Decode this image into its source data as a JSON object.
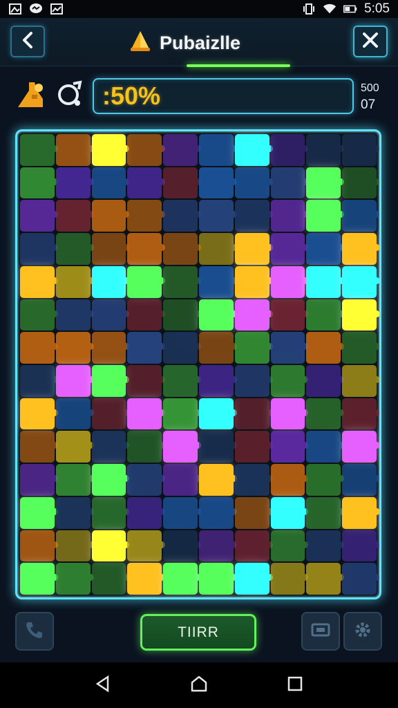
{
  "status_bar": {
    "time": "5:05",
    "left_icons": [
      "gallery-icon",
      "messenger-icon",
      "image-icon"
    ],
    "right_icons": [
      "vibrate-icon",
      "wifi-icon",
      "battery-icon"
    ]
  },
  "header": {
    "title": "Pubaizlle",
    "back_icon": "chevron-left-icon",
    "close_icon": "close-icon"
  },
  "progress": {
    "text": ":50%",
    "counter_top": "500",
    "counter_bottom": "07"
  },
  "tools": [
    "hint-icon",
    "shuffle-icon"
  ],
  "board": {
    "columns": 10,
    "rows": 14
  },
  "controls": {
    "main_button_label": "TIIRR",
    "left_icon": "phone-icon",
    "right_icons": [
      "screen-icon",
      "settings-icon"
    ]
  },
  "colors": {
    "accent_cyan": "#5fe3ff",
    "accent_green": "#63f25e",
    "progress_text": "#f4c21f"
  }
}
